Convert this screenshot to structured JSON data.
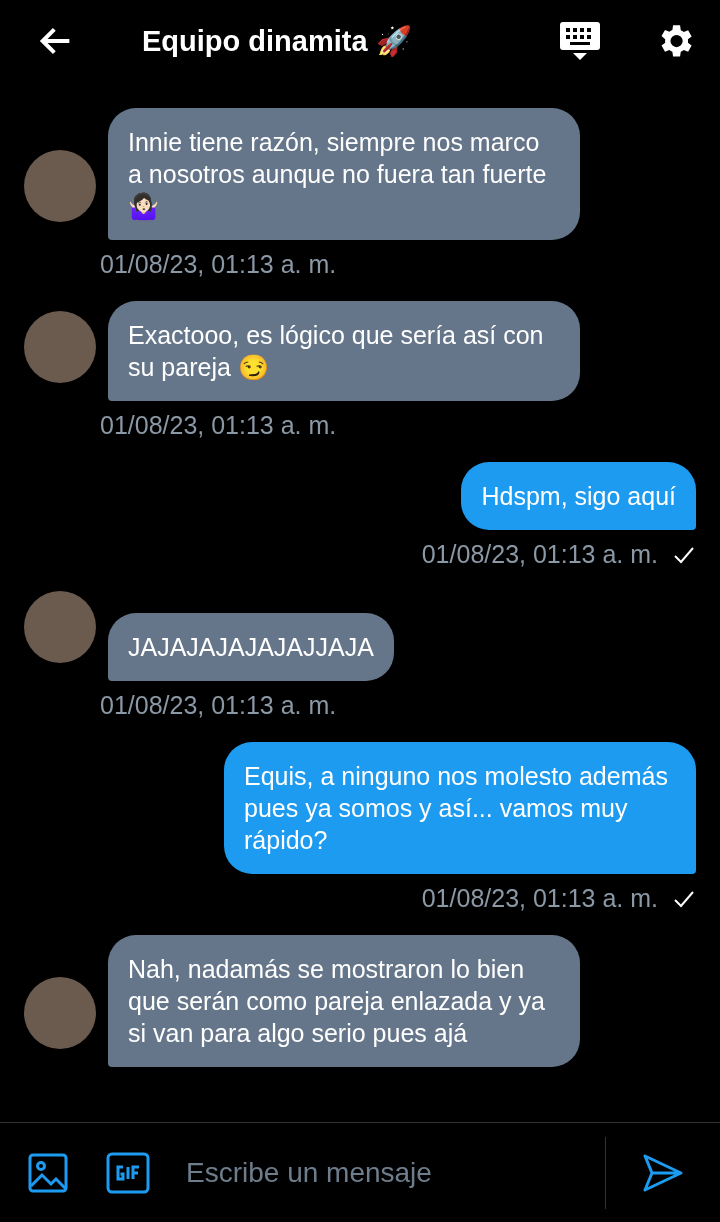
{
  "header": {
    "title": "Equipo dinamita 🚀"
  },
  "messages": [
    {
      "kind": "received",
      "text": "Innie tiene razón, siempre nos marco a nosotros aunque no fuera tan fuerte 🤷🏻‍♀️",
      "time": "01/08/23, 01:13 a. m."
    },
    {
      "kind": "received",
      "text": "Exactooo, es lógico que sería así con su pareja 😏",
      "time": "01/08/23, 01:13 a. m."
    },
    {
      "kind": "sent",
      "text": "Hdspm, sigo aquí",
      "time": "01/08/23, 01:13 a. m.",
      "read": true
    },
    {
      "kind": "received",
      "text": "JAJAJAJAJAJAJJAJA",
      "time": "01/08/23, 01:13 a. m."
    },
    {
      "kind": "sent",
      "text": "Equis, a ninguno nos molesto además pues ya somos y así... vamos muy rápido?",
      "time": "01/08/23, 01:13 a. m.",
      "read": true
    },
    {
      "kind": "received",
      "text": "Nah, nadamás se mostraron lo bien que serán como pareja enlazada y ya si van para algo serio pues ajá"
    }
  ],
  "composer": {
    "placeholder": "Escribe un mensaje"
  }
}
